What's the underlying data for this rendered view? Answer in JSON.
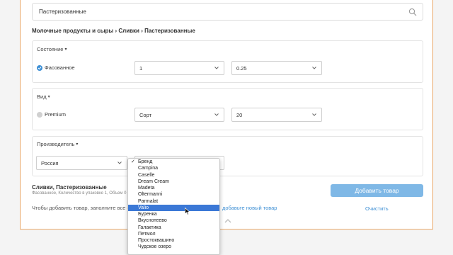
{
  "search": {
    "value": "Пастеризованные"
  },
  "breadcrumb": "Молочные продукты и сыры › Сливки › Пастеризованные",
  "condition": {
    "title": "Состояние",
    "option_label": "Фасованное",
    "select1_value": "1",
    "select2_value": "0.25"
  },
  "kind": {
    "title": "Вид",
    "option_label": "Premium",
    "select1_value": "Сорт",
    "select2_value": "20"
  },
  "manufacturer": {
    "title": "Производитель",
    "country_value": "Россия"
  },
  "summary": {
    "title": "Сливки, Пастеризованные",
    "subtitle": "Фасованное, Количество в упаковке 1, Объем 0"
  },
  "hint_text": "Чтобы добавить товар, заполните все о",
  "link_text": "добавьте новый товар",
  "add_button": "Добавить товар",
  "clear_button": "Очистить",
  "dropdown": {
    "selected_index": 0,
    "highlighted_index": 7,
    "options": [
      "Бренд",
      "Campina",
      "Caselle",
      "Dream Cream",
      "Madeta",
      "Oltermanni",
      "Parmalat",
      "Valio",
      "Буренка",
      "Вкуснотеево",
      "Галактика",
      "Петмол",
      "Простоквашино",
      "Чудское озеро"
    ]
  },
  "colors": {
    "accent": "#3d8fd4",
    "highlight": "#3b78d6",
    "frame_border": "#e8a86a",
    "button": "#7fb8e6"
  }
}
